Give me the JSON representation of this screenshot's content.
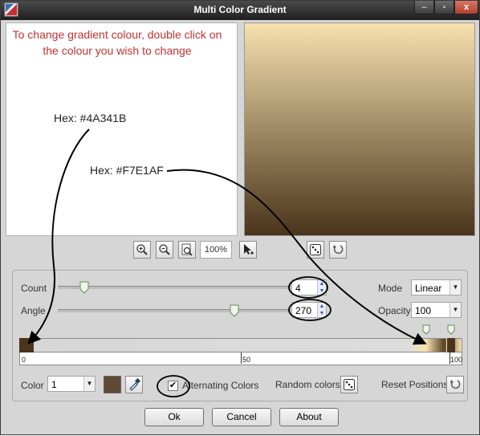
{
  "window": {
    "title": "Multi Color Gradient",
    "controls": {
      "minimize": "–",
      "maximize": "▫",
      "close": "x"
    }
  },
  "annotation": {
    "instruction": "To change gradient colour, double click on the colour you wish to change",
    "hex_start": "Hex: #4A341B",
    "hex_end": "Hex: #F7E1AF"
  },
  "preview": {
    "gradient_from": "#F7E1AF",
    "gradient_to": "#4A341B"
  },
  "toolbar": {
    "zoom_level": "100%",
    "icons": [
      "zoom-in-icon",
      "zoom-out-icon",
      "zoom-fit-icon",
      "add-stop-icon",
      "random-icon",
      "reset-icon"
    ]
  },
  "count": {
    "label": "Count",
    "value": "4"
  },
  "angle": {
    "label": "Angle",
    "value": "270"
  },
  "mode": {
    "label": "Mode",
    "value": "Linear"
  },
  "opacity": {
    "label": "Opacity",
    "value": "100"
  },
  "ruler": {
    "start": "0",
    "mid": "50",
    "end": "100"
  },
  "color_row": {
    "label": "Color",
    "index_value": "1",
    "swatch_color": "#5E4A35",
    "alternating_label": "Alternating Colors",
    "alternating_checked": "✔",
    "random_label": "Random colors",
    "reset_label": "Reset Positions"
  },
  "buttons": {
    "ok": "Ok",
    "cancel": "Cancel",
    "about": "About"
  }
}
